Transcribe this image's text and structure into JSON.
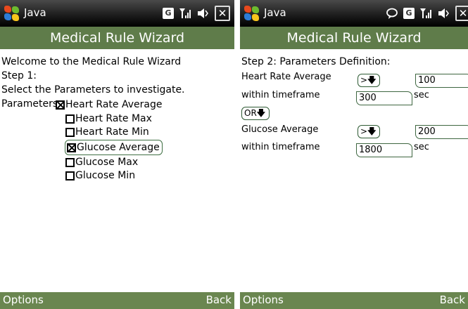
{
  "screens": [
    {
      "status": {
        "app": "Java"
      },
      "title": "Medical Rule Wizard",
      "lines": [
        "Welcome to the Medical Rule Wizard",
        "Step 1:",
        "Select the Parameters to investigate."
      ],
      "params_label": "Parameters",
      "checkboxes": [
        {
          "label": "Heart Rate Average",
          "checked": true
        },
        {
          "label": "Heart Rate Max",
          "checked": false
        },
        {
          "label": "Heart Rate Min",
          "checked": false
        },
        {
          "label": "Glucose Average",
          "checked": true
        },
        {
          "label": "Glucose Max",
          "checked": false
        },
        {
          "label": "Glucose Min",
          "checked": false
        }
      ],
      "softkeys": {
        "left": "Options",
        "right": "Back"
      }
    },
    {
      "status": {
        "app": "Java"
      },
      "title": "Medical Rule Wizard",
      "step": "Step 2: Parameters Definition:",
      "hr_label": "Heart Rate Average",
      "hr_op": ">",
      "hr_value": "100",
      "hr_tf_label": "within timeframe",
      "hr_tf_value": "300",
      "hr_unit": "sec",
      "logic": "OR",
      "gl_label": "Glucose Average",
      "gl_op": ">",
      "gl_value": "200",
      "gl_tf_label": "within timeframe",
      "gl_tf_value": "1800",
      "gl_unit": "sec",
      "softkeys": {
        "left": "Options",
        "right": "Back"
      }
    }
  ],
  "colors": {
    "titlebar": "#5f7c4a",
    "softbar": "#6a8650"
  }
}
